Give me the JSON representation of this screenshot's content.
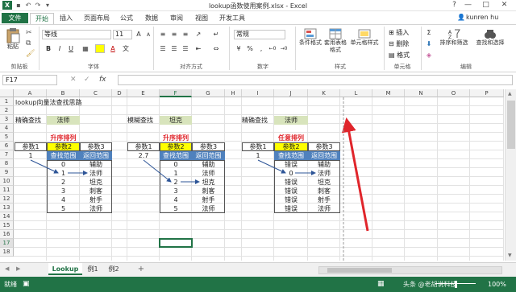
{
  "window": {
    "title": "lookup函数使用案例.xlsx - Excel",
    "logo": "X",
    "help": "?",
    "minimize": "—",
    "restore": "□",
    "close": "✕"
  },
  "tabs": [
    {
      "label": "文件"
    },
    {
      "label": "开始"
    },
    {
      "label": "插入"
    },
    {
      "label": "页面布局"
    },
    {
      "label": "公式"
    },
    {
      "label": "数据"
    },
    {
      "label": "审阅"
    },
    {
      "label": "视图"
    },
    {
      "label": "开发工具"
    }
  ],
  "user": {
    "name": "kunren hu",
    "icon": "person-icon"
  },
  "ribbon": {
    "paste": "粘贴",
    "clipboard_label": "剪贴板",
    "font_name": "等线",
    "font_size": "11",
    "font_label": "字体",
    "align_label": "对齐方式",
    "number_format": "常规",
    "number_label": "数字",
    "cond_format": "条件格式",
    "table_format": "套用表格格式",
    "cell_style": "单元格样式",
    "styles_label": "样式",
    "insert": "插入",
    "delete": "删除",
    "format": "格式",
    "cells_label": "单元格",
    "sort": "排序和筛选",
    "find": "查找和选择",
    "edit_label": "编辑",
    "bold": "B",
    "italic": "I",
    "underline": "U",
    "font_grow": "A",
    "font_shrink": "A",
    "font_color_letter": "A",
    "wen": "文",
    "percent": "%",
    "comma": ",",
    "dec_up": "←0",
    "dec_down": "→0"
  },
  "formula_bar": {
    "name_box": "F17",
    "cancel": "✕",
    "enter": "✓",
    "fx": "fx",
    "value": ""
  },
  "columns": [
    "A",
    "B",
    "C",
    "D",
    "E",
    "F",
    "G",
    "H",
    "I",
    "J",
    "K",
    "L",
    "M",
    "N",
    "O",
    "P"
  ],
  "rows": [
    "1",
    "2",
    "3",
    "4",
    "5",
    "6",
    "7",
    "8",
    "9",
    "10",
    "11",
    "12",
    "13",
    "14",
    "15",
    "16",
    "17",
    "18"
  ],
  "cells": {
    "a1": "lookup向量法查找思路",
    "a3": "精确查找",
    "b3": "法师",
    "b5": "升序排列",
    "a6": "参数1",
    "b6": "参数2",
    "c6": "参数3",
    "a7": "1",
    "b7": "查找范围",
    "c7": "返回范围",
    "b8": "0",
    "c8": "辅助",
    "b9": "1",
    "c9": "法师",
    "b10": "2",
    "c10": "坦克",
    "b11": "3",
    "c11": "刺客",
    "b12": "4",
    "c12": "射手",
    "b13": "5",
    "c13": "法师",
    "e3": "模糊查找",
    "f3": "坦克",
    "f5": "升序排列",
    "e6": "参数1",
    "f6": "参数2",
    "g6": "参数3",
    "e7": "2.7",
    "f7": "查找范围",
    "g7": "返回范围",
    "f8": "0",
    "g8": "辅助",
    "f9": "1",
    "g9": "法师",
    "f10": "2",
    "g10": "坦克",
    "f11": "3",
    "g11": "刺客",
    "f12": "4",
    "g12": "射手",
    "f13": "5",
    "g13": "法师",
    "i3": "精确查找",
    "j3": "法师",
    "j5": "任意排列",
    "i6": "参数1",
    "j6": "参数2",
    "k6": "参数3",
    "i7": "1",
    "j7": "查找范围",
    "k7": "返回范围",
    "j8": "错误",
    "k8": "辅助",
    "j9": "0",
    "k9": "法师",
    "j10": "错误",
    "k10": "坦克",
    "j11": "错误",
    "k11": "刺客",
    "j12": "错误",
    "k12": "射手",
    "j13": "错误",
    "k13": "法师"
  },
  "sheets": [
    {
      "label": "Lookup"
    },
    {
      "label": "例1"
    },
    {
      "label": "例2"
    }
  ],
  "add_sheet": "+",
  "status": {
    "ready": "就绪",
    "zoom": "100%",
    "watermark": "头条 @老胡说科技"
  },
  "colors": {
    "accent": "#217346",
    "arrow": "#e0252b",
    "header_blue": "#4f81bd",
    "green_cell": "#d8e4bc"
  }
}
